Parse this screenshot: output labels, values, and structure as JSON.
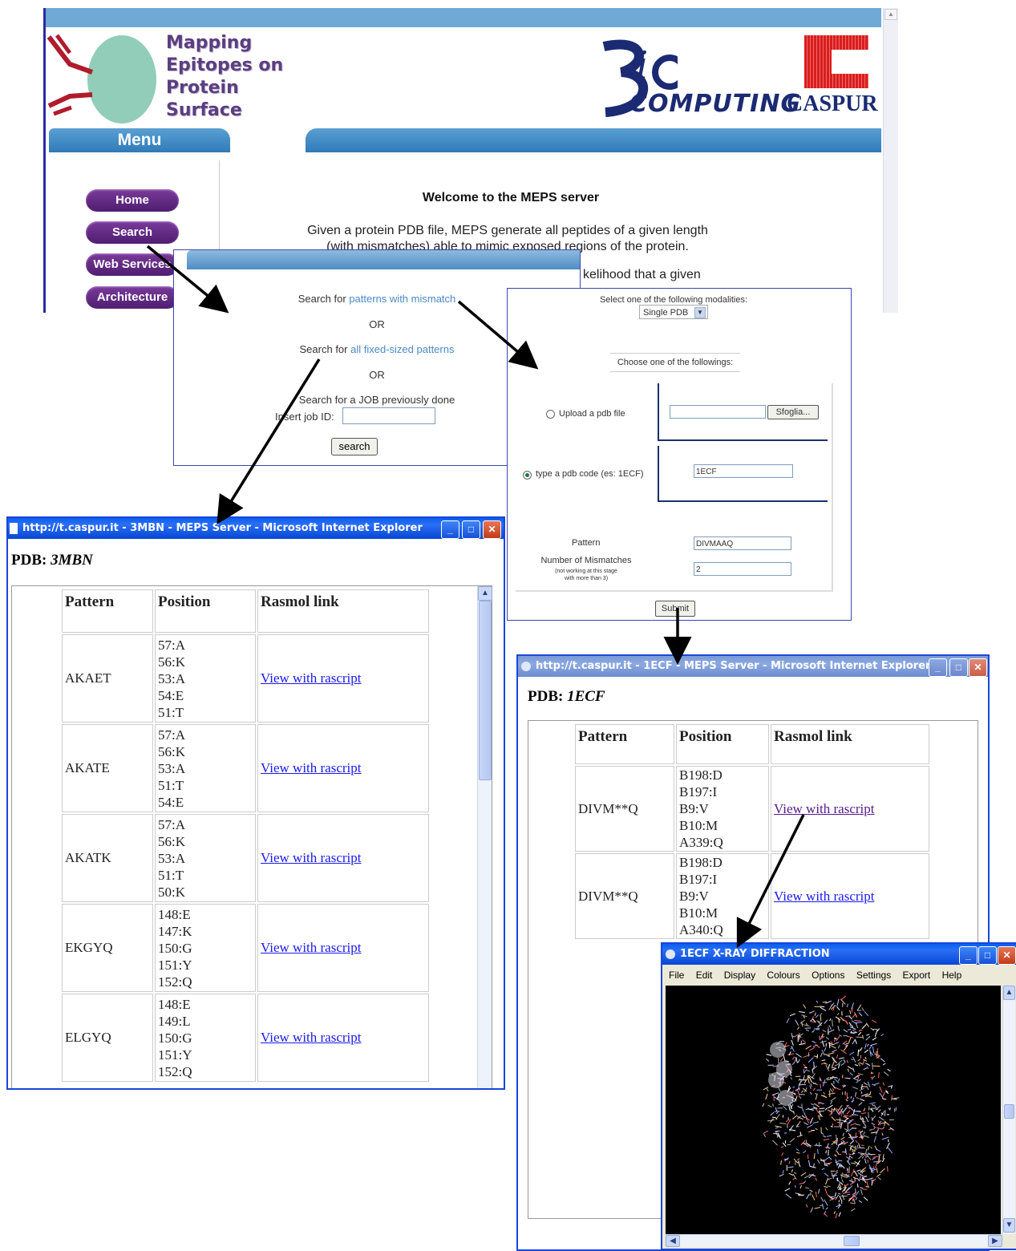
{
  "site": {
    "logo_lines": [
      "Mapping",
      "Epitopes on",
      "Protein",
      "Surface"
    ],
    "bio_logo": "COMPUTING",
    "caspur_logo": "CASPUR",
    "menu_label": "Menu",
    "nav": [
      "Home",
      "Search",
      "Web Services",
      "Architecture"
    ],
    "welcome": "Welcome to the MEPS server",
    "intro_line1": "Given a protein PDB file, MEPS generate all peptides of a given length",
    "intro_line2": "(with mismatches) able to mimic exposed regions of the protein.",
    "intro_line3": "kelihood that a given"
  },
  "search_panel": {
    "search_for": "Search for",
    "link_mismatch": "patterns with mismatch",
    "or": "OR",
    "link_fixed": "all fixed-sized patterns",
    "job_text": "Search for a JOB previously done",
    "job_label": "Insert job ID:",
    "job_value": "",
    "search_button": "search"
  },
  "form_panel": {
    "select_label": "Select one of the following modalities:",
    "select_value": "Single PDB",
    "choose_label": "Choose one of the followings:",
    "upload_label": "Upload a pdb file",
    "upload_value": "",
    "browse_button": "Sfoglia...",
    "code_label": "type a pdb code (es: 1ECF)",
    "code_value": "1ECF",
    "pattern_label": "Pattern",
    "pattern_value": "DIVMAAQ",
    "mismatch_label": "Number of Mismatches",
    "mismatch_note1": "(not working at this stage",
    "mismatch_note2": "with more than 3)",
    "mismatch_value": "2",
    "submit_button": "Submit"
  },
  "ie_left": {
    "title": "http://t.caspur.it - 3MBN - MEPS Server - Microsoft Internet Explorer",
    "pdb_label": "PDB:",
    "pdb_value": "3MBN",
    "headers": [
      "Pattern",
      "Position",
      "Rasmol link"
    ],
    "rows": [
      {
        "pattern": "AKAET",
        "positions": [
          "57:A",
          "56:K",
          "53:A",
          "54:E",
          "51:T"
        ],
        "link": "View with rascript"
      },
      {
        "pattern": "AKATE",
        "positions": [
          "57:A",
          "56:K",
          "53:A",
          "51:T",
          "54:E"
        ],
        "link": "View with rascript"
      },
      {
        "pattern": "AKATK",
        "positions": [
          "57:A",
          "56:K",
          "53:A",
          "51:T",
          "50:K"
        ],
        "link": "View with rascript"
      },
      {
        "pattern": "EKGYQ",
        "positions": [
          "148:E",
          "147:K",
          "150:G",
          "151:Y",
          "152:Q"
        ],
        "link": "View with rascript"
      },
      {
        "pattern": "ELGYQ",
        "positions": [
          "148:E",
          "149:L",
          "150:G",
          "151:Y",
          "152:Q"
        ],
        "link": "View with rascript"
      }
    ]
  },
  "ie_right": {
    "title": "http://t.caspur.it - 1ECF - MEPS Server - Microsoft Internet Explorer",
    "pdb_label": "PDB:",
    "pdb_value": "1ECF",
    "headers": [
      "Pattern",
      "Position",
      "Rasmol link"
    ],
    "rows": [
      {
        "pattern": "DIVM**Q",
        "positions": [
          "B198:D",
          "B197:I",
          "B9:V",
          "B10:M",
          "A339:Q"
        ],
        "link": "View with rascript"
      },
      {
        "pattern": "DIVM**Q",
        "positions": [
          "B198:D",
          "B197:I",
          "B9:V",
          "B10:M",
          "A340:Q"
        ],
        "link": "View with rascript"
      }
    ]
  },
  "rasmol": {
    "title": "1ECF X-RAY DIFFRACTION",
    "menu": [
      "File",
      "Edit",
      "Display",
      "Colours",
      "Options",
      "Settings",
      "Export",
      "Help"
    ]
  },
  "colors": {
    "nav_pill": "#5a2a82",
    "header_bar": "#3f86c4",
    "xp_title": "#0a5ff0",
    "link": "#4a8ac4"
  }
}
